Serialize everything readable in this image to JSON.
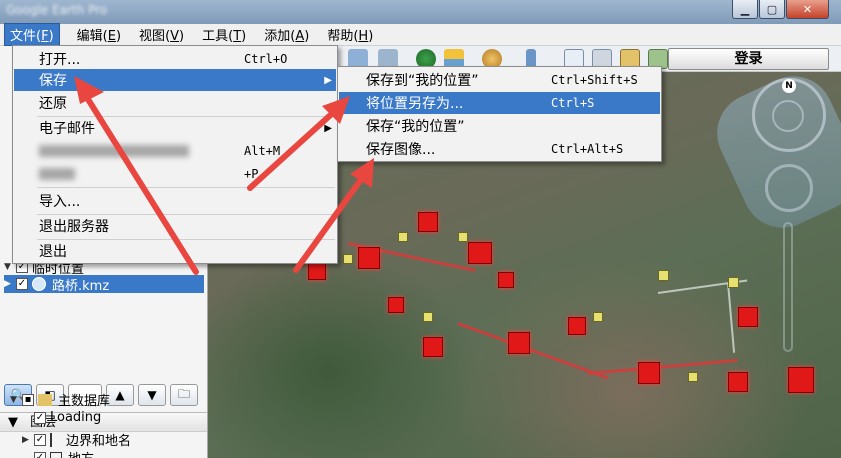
{
  "titlebar": {
    "title": "Google Earth Pro",
    "minimize_icon": "minimize-icon",
    "maximize_icon": "maximize-icon",
    "close_icon": "close-icon"
  },
  "menubar": {
    "items": [
      {
        "label": "文件",
        "hotkey": "F"
      },
      {
        "label": "编辑",
        "hotkey": "E"
      },
      {
        "label": "视图",
        "hotkey": "V"
      },
      {
        "label": "工具",
        "hotkey": "T"
      },
      {
        "label": "添加",
        "hotkey": "A"
      },
      {
        "label": "帮助",
        "hotkey": "H"
      }
    ]
  },
  "toolbar": {
    "icons": [
      "placemark-icon",
      "polygon-icon",
      "path-icon",
      "overlay-icon",
      "tour-icon",
      "history-clock-icon",
      "sun-icon",
      "planet-icon",
      "ruler-icon",
      "email-icon",
      "print-icon",
      "google-maps-icon",
      "save-image-icon"
    ],
    "login_label": "登录"
  },
  "file_menu": {
    "items": [
      {
        "label": "打开...",
        "shortcut": "Ctrl+O"
      },
      {
        "label": "保存",
        "shortcut": "",
        "submenu": true
      },
      {
        "label": "还原",
        "shortcut": ""
      },
      {
        "label": "电子邮件",
        "shortcut": "",
        "submenu": true
      },
      {
        "label": "",
        "shortcut": "Alt+M"
      },
      {
        "label": "",
        "shortcut": "+P"
      },
      {
        "label": "导入...",
        "shortcut": ""
      },
      {
        "label": "退出服务器",
        "shortcut": ""
      },
      {
        "label": "退出",
        "shortcut": ""
      }
    ]
  },
  "save_submenu": {
    "items": [
      {
        "label": "保存到“我的位置”",
        "shortcut": "Ctrl+Shift+S"
      },
      {
        "label": "将位置另存为...",
        "shortcut": "Ctrl+S"
      },
      {
        "label": "保存“我的位置”",
        "shortcut": ""
      },
      {
        "label": "保存图像...",
        "shortcut": "Ctrl+Alt+S"
      }
    ]
  },
  "places": {
    "temp_label": "临时位置",
    "file_label": "路桥.kmz"
  },
  "layers": {
    "header": "图层",
    "items": [
      {
        "label": "主数据库"
      },
      {
        "label": "Loading"
      },
      {
        "label": "边界和地名"
      },
      {
        "label": "地方"
      }
    ]
  },
  "nav": {
    "north": "N"
  },
  "colors": {
    "highlight": "#3a78c8",
    "annotation_arrow": "#e8463f"
  }
}
